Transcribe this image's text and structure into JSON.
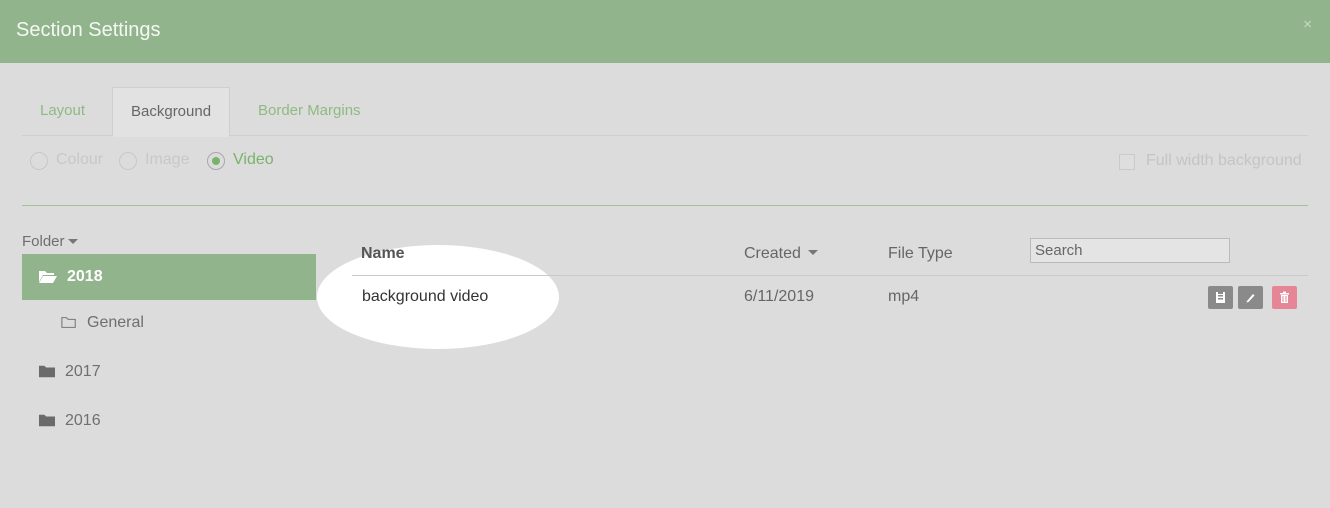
{
  "dialog": {
    "title": "Section Settings",
    "close_icon": "×"
  },
  "tabs": [
    {
      "label": "Layout",
      "active": false
    },
    {
      "label": "Background",
      "active": true
    },
    {
      "label": "Border Margins",
      "active": false
    }
  ],
  "background_type": {
    "options": [
      {
        "label": "Colour",
        "checked": false
      },
      {
        "label": "Image",
        "checked": false
      },
      {
        "label": "Video",
        "checked": true
      }
    ],
    "full_width_label": "Full width background",
    "full_width_checked": false
  },
  "folders": {
    "header": "Folder",
    "items": [
      {
        "label": "2018",
        "icon": "folder-open-icon",
        "active": true
      },
      {
        "label": "General",
        "icon": "folder-outline-icon",
        "active": false
      },
      {
        "label": "2017",
        "icon": "folder-icon",
        "active": false
      },
      {
        "label": "2016",
        "icon": "folder-icon",
        "active": false
      }
    ]
  },
  "files": {
    "columns": {
      "name": "Name",
      "created": "Created",
      "file_type": "File Type"
    },
    "search": {
      "placeholder": "Search",
      "value": ""
    },
    "rows": [
      {
        "name": "background video",
        "created": "6/11/2019",
        "file_type": "mp4",
        "actions": [
          "copy-icon",
          "edit-icon",
          "delete-icon"
        ]
      }
    ]
  },
  "colors": {
    "header": "#92b48c",
    "accent": "#79b36b",
    "delete": "#e58596",
    "body": "#dcdcdc"
  }
}
